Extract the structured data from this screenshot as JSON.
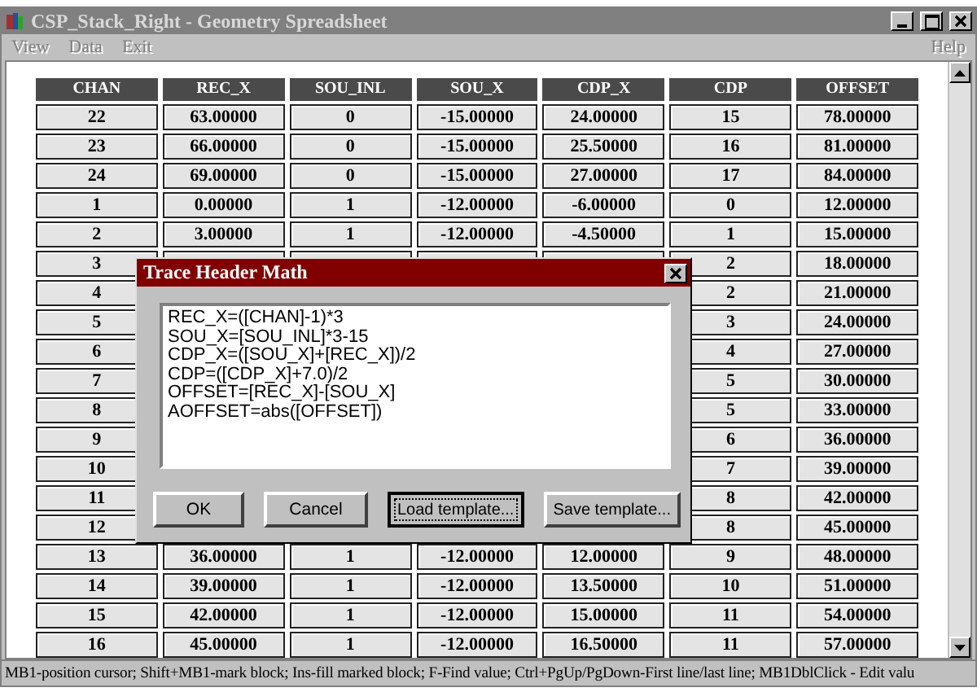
{
  "window": {
    "title": "CSP_Stack_Right - Geometry Spreadsheet"
  },
  "menu": {
    "left": [
      "View",
      "Data",
      "Exit"
    ],
    "right": [
      "Help"
    ]
  },
  "table": {
    "columns": [
      "CHAN",
      "REC_X",
      "SOU_INL",
      "SOU_X",
      "CDP_X",
      "CDP",
      "OFFSET"
    ],
    "rows": [
      [
        "22",
        "63.00000",
        "0",
        "-15.00000",
        "24.00000",
        "15",
        "78.00000"
      ],
      [
        "23",
        "66.00000",
        "0",
        "-15.00000",
        "25.50000",
        "16",
        "81.00000"
      ],
      [
        "24",
        "69.00000",
        "0",
        "-15.00000",
        "27.00000",
        "17",
        "84.00000"
      ],
      [
        "1",
        "0.00000",
        "1",
        "-12.00000",
        "-6.00000",
        "0",
        "12.00000"
      ],
      [
        "2",
        "3.00000",
        "1",
        "-12.00000",
        "-4.50000",
        "1",
        "15.00000"
      ],
      [
        "3",
        null,
        null,
        null,
        null,
        "2",
        "18.00000"
      ],
      [
        "4",
        null,
        null,
        null,
        null,
        "2",
        "21.00000"
      ],
      [
        "5",
        null,
        null,
        null,
        null,
        "3",
        "24.00000"
      ],
      [
        "6",
        null,
        null,
        null,
        null,
        "4",
        "27.00000"
      ],
      [
        "7",
        null,
        null,
        null,
        null,
        "5",
        "30.00000"
      ],
      [
        "8",
        null,
        null,
        null,
        null,
        "5",
        "33.00000"
      ],
      [
        "9",
        null,
        null,
        null,
        null,
        "6",
        "36.00000"
      ],
      [
        "10",
        null,
        null,
        null,
        null,
        "7",
        "39.00000"
      ],
      [
        "11",
        null,
        null,
        null,
        null,
        "8",
        "42.00000"
      ],
      [
        "12",
        null,
        null,
        null,
        null,
        "8",
        "45.00000"
      ],
      [
        "13",
        "36.00000",
        "1",
        "-12.00000",
        "12.00000",
        "9",
        "48.00000"
      ],
      [
        "14",
        "39.00000",
        "1",
        "-12.00000",
        "13.50000",
        "10",
        "51.00000"
      ],
      [
        "15",
        "42.00000",
        "1",
        "-12.00000",
        "15.00000",
        "11",
        "54.00000"
      ],
      [
        "16",
        "45.00000",
        "1",
        "-12.00000",
        "16.50000",
        "11",
        "57.00000"
      ]
    ]
  },
  "dialog": {
    "title": "Trace Header Math",
    "lines": [
      "REC_X=([CHAN]-1)*3",
      "SOU_X=[SOU_INL]*3-15",
      "CDP_X=([SOU_X]+[REC_X])/2",
      "CDP=([CDP_X]+7.0)/2",
      "OFFSET=[REC_X]-[SOU_X]",
      "AOFFSET=abs([OFFSET])"
    ],
    "buttons": [
      {
        "label": "OK",
        "focused": false
      },
      {
        "label": "Cancel",
        "focused": false
      },
      {
        "label": "Load template...",
        "focused": true
      },
      {
        "label": "Save template...",
        "focused": false
      }
    ]
  },
  "status_bar": "MB1-position cursor; Shift+MB1-mark block; Ins-fill marked block; F-Find value; Ctrl+PgUp/PgDown-First line/last line; MB1DblClick - Edit valu"
}
